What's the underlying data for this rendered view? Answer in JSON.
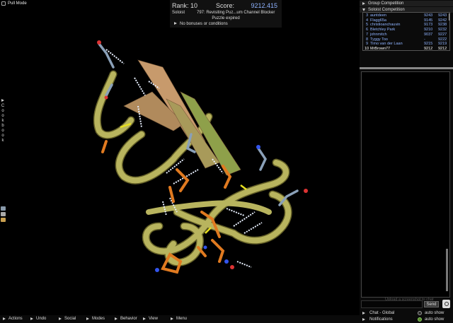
{
  "mode": {
    "label": "Pull Mode"
  },
  "score_panel": {
    "rank_label": "Rank: 10",
    "score_label": "Score:",
    "score_value": "9212.415",
    "soloist_label": "Soloist",
    "puzzle_title": "797: Revisiting Puz...um Channel Blocker",
    "status": "Puzzle expired"
  },
  "bonus": {
    "label": "No bonuses or conditions"
  },
  "cookbook": {
    "label": "Cookbook"
  },
  "right_panel": {
    "group_competition": "Group Competition",
    "soloist_competition": "Soloist Competition",
    "leaderboard": [
      {
        "rank": "3",
        "name": "auntdeen",
        "score": "9243",
        "score2": "9243"
      },
      {
        "rank": "4",
        "name": "Flagg65a",
        "score": "9145",
        "score2": "9242"
      },
      {
        "rank": "5",
        "name": "christioanchauvin",
        "score": "9173",
        "score2": "9238"
      },
      {
        "rank": "6",
        "name": "Bletchley Park",
        "score": "9210",
        "score2": "9232"
      },
      {
        "rank": "7",
        "name": "johnmitch",
        "score": "9037",
        "score2": "9227"
      },
      {
        "rank": "8",
        "name": "Tyggy Too",
        "score": "-",
        "score2": "9222"
      },
      {
        "rank": "9",
        "name": "Timo van der Laan",
        "score": "9215",
        "score2": "9219"
      },
      {
        "rank": "10",
        "name": "MrBrown77",
        "score": "9212",
        "score2": "9212"
      }
    ],
    "upload_text": "Upload a screenshot to chat",
    "send_label": "Send",
    "chat_global": "Chat - Global",
    "notifications": "Notifications",
    "auto_show": "auto show"
  },
  "menu": {
    "actions": "Actions",
    "undo": "Undo",
    "social": "Social",
    "modes": "Modes",
    "behavior": "Behavior",
    "view": "View",
    "menu": "Menu"
  },
  "colors": {
    "background": "#000000",
    "backbone": "#b8b45e",
    "sheet": "#c79a6c",
    "carbon_orange": "#e07a20",
    "carbon_gray": "#8aa0b8",
    "hbond": "#e8f0ff",
    "score_blue": "#8fb3ff"
  }
}
